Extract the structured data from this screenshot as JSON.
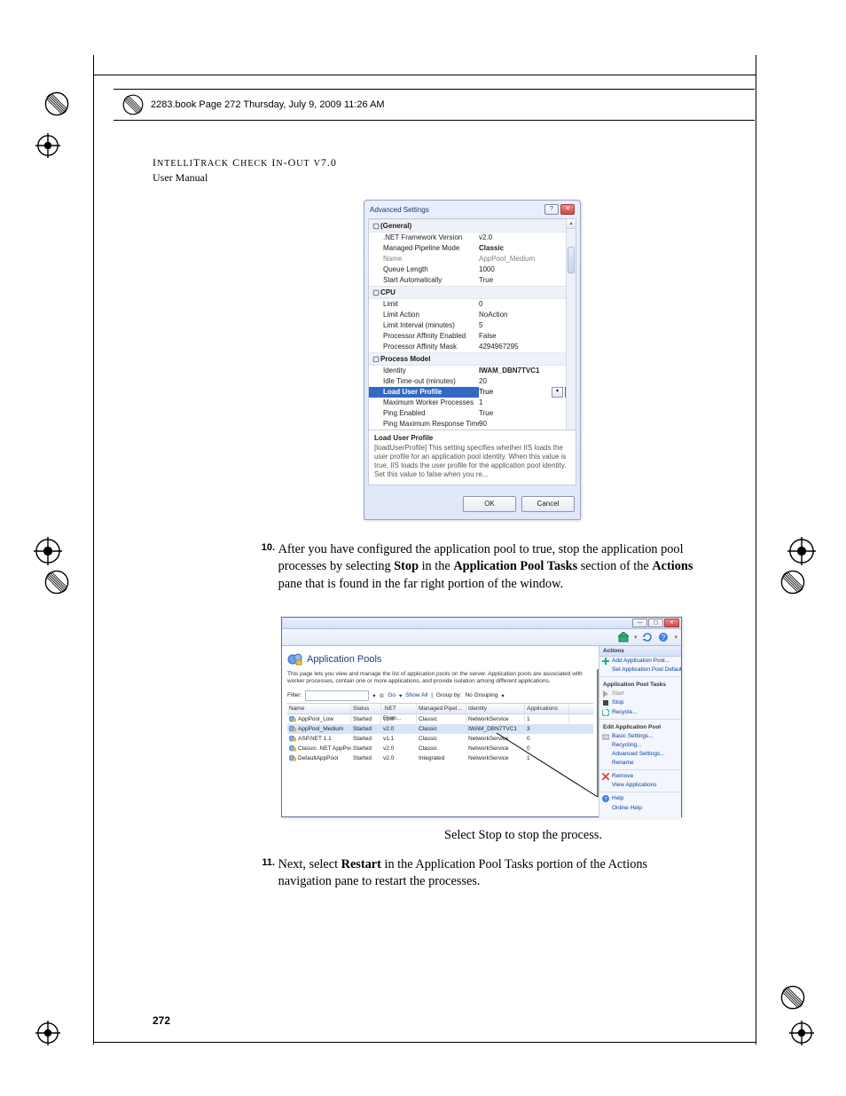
{
  "bookline": "2283.book  Page 272  Thursday, July 9, 2009  11:26 AM",
  "runhead_title": "IntelliTrack Check In-Out v7.0",
  "runhead_sub": "User Manual",
  "adv": {
    "title": "Advanced Settings",
    "sections": {
      "general": "(General)",
      "cpu": "CPU",
      "proc": "Process Model"
    },
    "rows": {
      "net_fw": ".NET Framework Version",
      "net_fw_v": "v2.0",
      "pipe": "Managed Pipeline Mode",
      "pipe_v": "Classic",
      "name": "Name",
      "name_v": "AppPool_Medium",
      "ql": "Queue Length",
      "ql_v": "1000",
      "sa": "Start Automatically",
      "sa_v": "True",
      "lim": "Limit",
      "lim_v": "0",
      "lima": "Limit Action",
      "lima_v": "NoAction",
      "limi": "Limit Interval (minutes)",
      "limi_v": "5",
      "pae": "Processor Affinity Enabled",
      "pae_v": "False",
      "pam": "Processor Affinity Mask",
      "pam_v": "4294967295",
      "ident": "Identity",
      "ident_v": "IWAM_DBN7TVC1",
      "idle": "Idle Time-out (minutes)",
      "idle_v": "20",
      "lup": "Load User Profile",
      "lup_v": "True",
      "mwp": "Maximum Worker Processes",
      "mwp_v": "1",
      "pe": "Ping Enabled",
      "pe_v": "True",
      "pmrt": "Ping Maximum Response Time (s",
      "pmrt_v": "90"
    },
    "desc_title": "Load User Profile",
    "desc_body": "[loadUserProfile] This setting specifies whether IIS loads the user profile for an application pool identity. When this value is true, IIS loads the user profile for the application pool identity. Set this value to false when you re...",
    "ok": "OK",
    "cancel": "Cancel"
  },
  "step10": {
    "num": "10.",
    "text_before": "After you have configured the application pool to true, stop the application pool processes by selecting ",
    "stop": "Stop",
    "mid1": " in the ",
    "apt": "Application Pool Tasks",
    "mid2": " section of the ",
    "actions": "Actions",
    "tail": " pane that is found in the far right portion of the window."
  },
  "iis": {
    "header": "Application Pools",
    "desc": "This page lets you view and manage the list of application pools on the server. Application pools are associated with worker processes, contain one or more applications, and provide isolation among different applications.",
    "filter_label": "Filter:",
    "go": "Go",
    "showall": "Show All",
    "groupby": "Group by:",
    "groupval": "No Grouping",
    "cols": {
      "name": "Name",
      "status": "Status",
      "net": ".NET Fram...",
      "pipe": "Managed Pipel...",
      "ident": "Identity",
      "apps": "Applications"
    },
    "rows": [
      {
        "name": "AppPool_Low",
        "status": "Started",
        "net": "v2.0",
        "pipe": "Classic",
        "ident": "NetworkService",
        "apps": "1",
        "sel": false
      },
      {
        "name": "AppPool_Medium",
        "status": "Started",
        "net": "v2.0",
        "pipe": "Classic",
        "ident": "IWAM_DBN7TVC1",
        "apps": "3",
        "sel": true
      },
      {
        "name": "ASP.NET 1.1",
        "status": "Started",
        "net": "v1.1",
        "pipe": "Classic",
        "ident": "NetworkService",
        "apps": "0",
        "sel": false
      },
      {
        "name": "Classic .NET AppPool",
        "status": "Started",
        "net": "v2.0",
        "pipe": "Classic",
        "ident": "NetworkService",
        "apps": "0",
        "sel": false
      },
      {
        "name": "DefaultAppPool",
        "status": "Started",
        "net": "v2.0",
        "pipe": "Integrated",
        "ident": "NetworkService",
        "apps": "1",
        "sel": false
      }
    ],
    "actions": {
      "head": "Actions",
      "add": "Add Application Pool...",
      "setdef": "Set Application Pool Defaults...",
      "tasks": "Application Pool Tasks",
      "start": "Start",
      "stop": "Stop",
      "recycle": "Recycle...",
      "edit": "Edit Application Pool",
      "basic": "Basic Settings...",
      "recycling": "Recycling...",
      "advset": "Advanced Settings...",
      "rename": "Rename",
      "remove": "Remove",
      "viewapps": "View Applications",
      "help": "Help",
      "online": "Online Help"
    }
  },
  "caption": "Select Stop to stop the process.",
  "step11": {
    "num": "11.",
    "before": "Next, select ",
    "restart": "Restart",
    "after": " in the Application Pool Tasks portion of the Actions navigation pane to restart the processes."
  },
  "pagenum": "272"
}
